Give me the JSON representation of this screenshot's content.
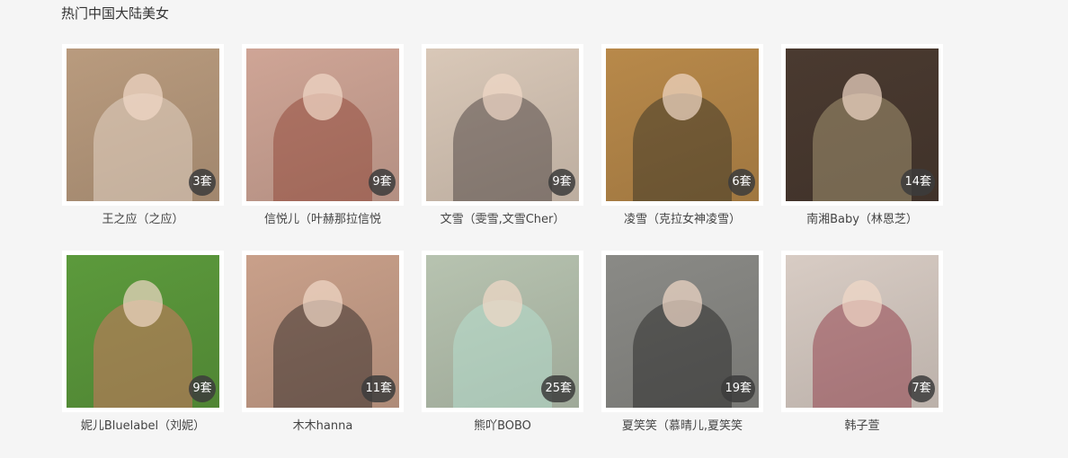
{
  "section": {
    "title": "热门中国大陆美女"
  },
  "models": [
    {
      "name": "王之应（之应）",
      "count": "3套",
      "bg": "#b99b7e",
      "tone": "#efe3d6"
    },
    {
      "name": "信悦儿（叶赫那拉信悦",
      "count": "9套",
      "bg": "#cfa596",
      "tone": "#8a3a2a"
    },
    {
      "name": "文雪（雯雪,文雪Cher）",
      "count": "9套",
      "bg": "#d9c8b8",
      "tone": "#3a3030"
    },
    {
      "name": "凌雪（克拉女神凌雪）",
      "count": "6套",
      "bg": "#b8894a",
      "tone": "#2a2a22"
    },
    {
      "name": "南湘Baby（林恩芝）",
      "count": "14套",
      "bg": "#4a3a30",
      "tone": "#b8a880"
    },
    {
      "name": "妮儿Bluelabel（刘妮）",
      "count": "9套",
      "bg": "#5c9a3c",
      "tone": "#e8706a"
    },
    {
      "name": "木木hanna",
      "count": "11套",
      "bg": "#c9a08a",
      "tone": "#1e1a1a"
    },
    {
      "name": "熊吖BOBO",
      "count": "25套",
      "bg": "#b7c3b0",
      "tone": "#b8e6d8"
    },
    {
      "name": "夏笑笑（慕晴儿,夏笑笑",
      "count": "19套",
      "bg": "#8a8a86",
      "tone": "#1a1a1a"
    },
    {
      "name": "韩子萱",
      "count": "7套",
      "bg": "#d8ccc4",
      "tone": "#8a2a3a"
    }
  ]
}
